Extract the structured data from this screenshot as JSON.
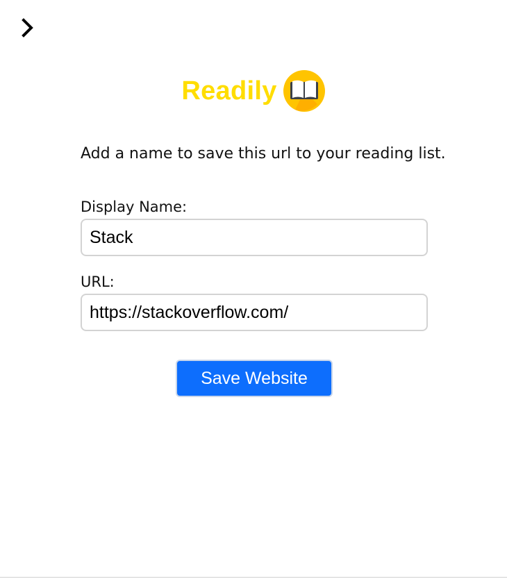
{
  "header": {
    "toggle_icon": "chevron-right-icon"
  },
  "brand": {
    "title": "Readily",
    "logo_icon": "open-book-icon",
    "color": "#ffdd00"
  },
  "instruction": "Add a name to save this url to your reading list.",
  "form": {
    "display_name": {
      "label": "Display Name:",
      "value": "Stack"
    },
    "url": {
      "label": "URL:",
      "value": "https://stackoverflow.com/"
    },
    "save_label": "Save Website"
  },
  "colors": {
    "accent": "#0d6efd",
    "input_border": "#d3d3d3"
  }
}
